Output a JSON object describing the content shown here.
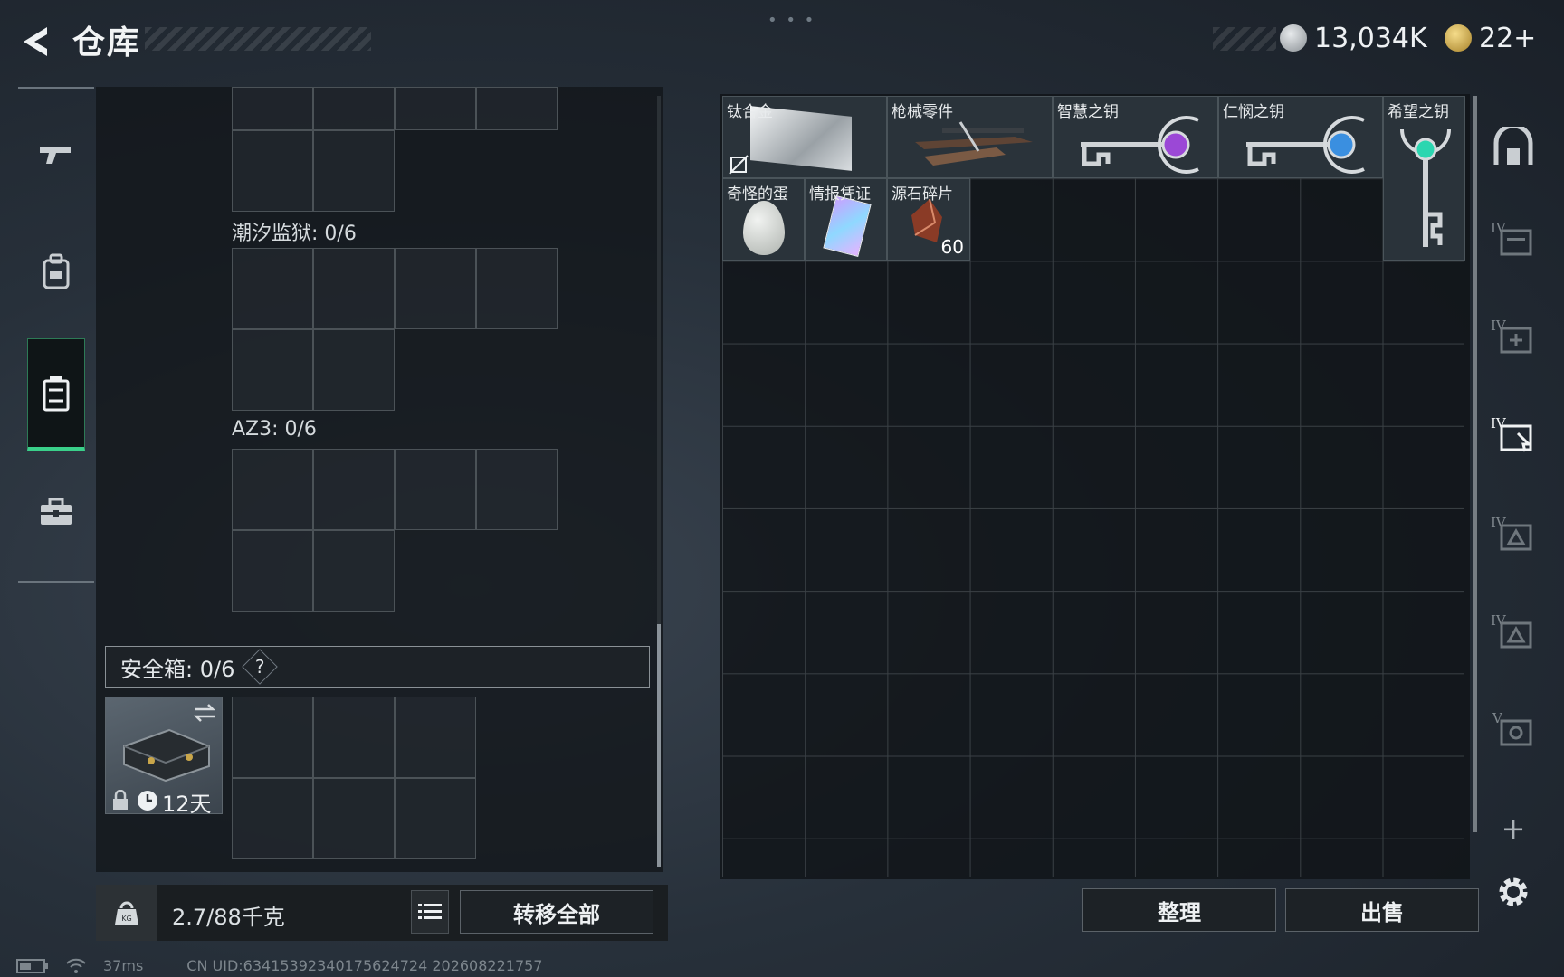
{
  "header": {
    "title": "仓库",
    "currency_silver": "13,034K",
    "currency_gold": "22+",
    "colors": {
      "silver": "#b9bfc4",
      "gold": "#d8b04a"
    }
  },
  "left_nav": {
    "items": [
      "gun-icon",
      "backpack-icon",
      "case-icon",
      "toolbox-icon"
    ],
    "active_index": 2,
    "accent": "#3ad08a"
  },
  "containers": {
    "tide_prison": "潮汐监狱: 0/6",
    "az3": "AZ3: 0/6"
  },
  "safebox": {
    "label": "安全箱:  0/6",
    "help": "?",
    "timer": "12天"
  },
  "footer": {
    "weight": "2.7/88千克",
    "transfer_all": "转移全部",
    "sort": "整理",
    "sell": "出售"
  },
  "stash_items": [
    {
      "name": "钛合金",
      "count": ""
    },
    {
      "name": "枪械零件",
      "count": ""
    },
    {
      "name": "智慧之钥",
      "count": ""
    },
    {
      "name": "仁悯之钥",
      "count": ""
    },
    {
      "name": "希望之钥",
      "count": ""
    },
    {
      "name": "奇怪的蛋",
      "count": ""
    },
    {
      "name": "情报凭证",
      "count": ""
    },
    {
      "name": "源石碎片",
      "count": "60"
    }
  ],
  "right_sidebar": {
    "tiers": [
      "IV",
      "IV",
      "IV",
      "IV",
      "IV",
      "V"
    ],
    "plus": "+"
  },
  "status_bar": {
    "ping": "37ms",
    "uid": "CN UID:634153923401756247​24 202608221757"
  }
}
